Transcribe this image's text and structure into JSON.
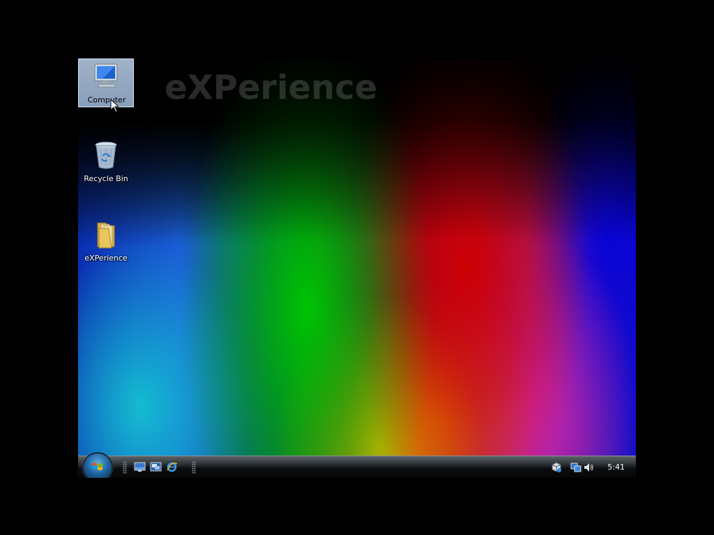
{
  "desktop": {
    "watermark": "eXPerience",
    "icons": [
      {
        "label": "Computer",
        "selected": true
      },
      {
        "label": "Recycle Bin",
        "selected": false
      },
      {
        "label": "eXPerience",
        "selected": false
      }
    ]
  },
  "taskbar": {
    "start_icon": "windows-orb-icon",
    "quick_launch": [
      "show-desktop-icon",
      "switch-windows-icon",
      "internet-explorer-icon"
    ],
    "tray_icons": [
      "network-cube-icon",
      "network-status-icon",
      "volume-icon"
    ],
    "clock": "5:41"
  },
  "colors": {
    "taskbar_top": "#5d6469",
    "taskbar_bottom": "#050607",
    "selection": "#a6bedd"
  }
}
